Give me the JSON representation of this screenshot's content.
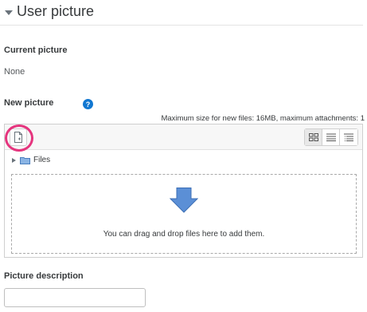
{
  "section": {
    "title": "User picture"
  },
  "current_picture": {
    "label": "Current picture",
    "value": "None"
  },
  "new_picture": {
    "label": "New picture",
    "help_icon": "question-circle-icon",
    "max_size_text": "Maximum size for new files: 16MB, maximum attachments: 1",
    "toolbar": {
      "add_file_icon": "add-file-icon",
      "view_icons": [
        "grid-view-icon",
        "list-view-icon",
        "tree-view-icon"
      ]
    },
    "path": {
      "folder_label": "Files"
    },
    "drop_zone_text": "You can drag and drop files here to add them."
  },
  "picture_description": {
    "label": "Picture description",
    "value": ""
  },
  "colors": {
    "accent": "#1177d1",
    "highlight_ring": "#e5357e",
    "arrow": "#5b8fd6"
  }
}
